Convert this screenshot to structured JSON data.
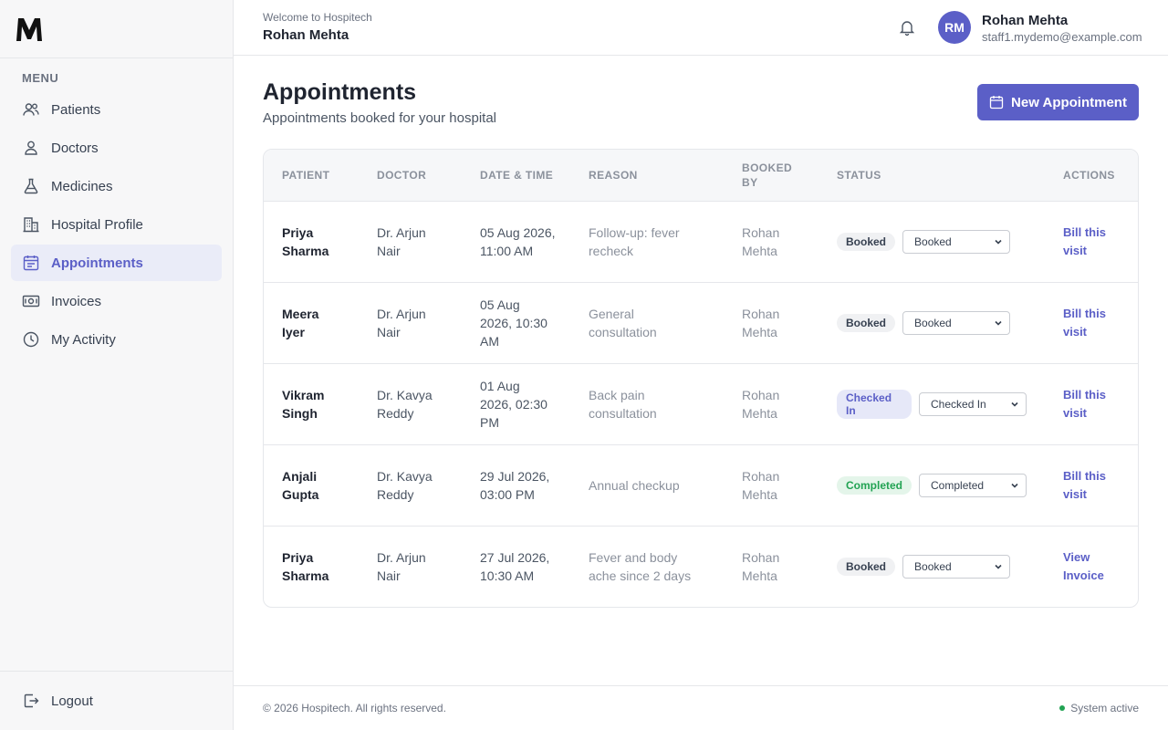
{
  "sidebar": {
    "logo": "M",
    "menu_title": "MENU",
    "items": [
      {
        "label": "Patients",
        "icon": "users-icon"
      },
      {
        "label": "Doctors",
        "icon": "user-icon"
      },
      {
        "label": "Medicines",
        "icon": "flask-icon"
      },
      {
        "label": "Hospital Profile",
        "icon": "building-icon"
      },
      {
        "label": "Appointments",
        "icon": "calendar-icon",
        "active": true
      },
      {
        "label": "Invoices",
        "icon": "cash-icon"
      },
      {
        "label": "My Activity",
        "icon": "clock-icon"
      }
    ],
    "logout_label": "Logout"
  },
  "header": {
    "welcome": "Welcome to Hospitech",
    "welcome_name": "Rohan Mehta",
    "avatar_initials": "RM",
    "user_name": "Rohan Mehta",
    "user_email": "staff1.mydemo@example.com"
  },
  "main": {
    "title": "Appointments",
    "subtitle": "Appointments booked for your hospital",
    "new_button": "New Appointment",
    "columns": [
      "PATIENT",
      "DOCTOR",
      "DATE & TIME",
      "REASON",
      "BOOKED BY",
      "STATUS",
      "ACTIONS"
    ],
    "rows": [
      {
        "patient": "Priya Sharma",
        "doctor": "Dr. Arjun Nair",
        "datetime": "05 Aug 2026, 11:00 AM",
        "reason": "Follow-up: fever recheck",
        "booked_by": "Rohan Mehta",
        "status": "Booked",
        "select": "Booked",
        "action": "Bill this visit"
      },
      {
        "patient": "Meera Iyer",
        "doctor": "Dr. Arjun Nair",
        "datetime": "05 Aug 2026, 10:30 AM",
        "reason": "General consultation",
        "booked_by": "Rohan Mehta",
        "status": "Booked",
        "select": "Booked",
        "action": "Bill this visit"
      },
      {
        "patient": "Vikram Singh",
        "doctor": "Dr. Kavya Reddy",
        "datetime": "01 Aug 2026, 02:30 PM",
        "reason": "Back pain consultation",
        "booked_by": "Rohan Mehta",
        "status": "Checked In",
        "select": "Checked In",
        "action": "Bill this visit"
      },
      {
        "patient": "Anjali Gupta",
        "doctor": "Dr. Kavya Reddy",
        "datetime": "29 Jul 2026, 03:00 PM",
        "reason": "Annual checkup",
        "booked_by": "Rohan Mehta",
        "status": "Completed",
        "select": "Completed",
        "action": "Bill this visit"
      },
      {
        "patient": "Priya Sharma",
        "doctor": "Dr. Arjun Nair",
        "datetime": "27 Jul 2026, 10:30 AM",
        "reason": "Fever and body ache since 2 days",
        "booked_by": "Rohan Mehta",
        "status": "Booked",
        "select": "Booked",
        "action": "View Invoice"
      }
    ]
  },
  "footer": {
    "copyright": "© 2026 Hospitech. All rights reserved.",
    "system_status": "System active"
  },
  "colors": {
    "accent": "#5b5fc7",
    "completed": "#22a353"
  }
}
